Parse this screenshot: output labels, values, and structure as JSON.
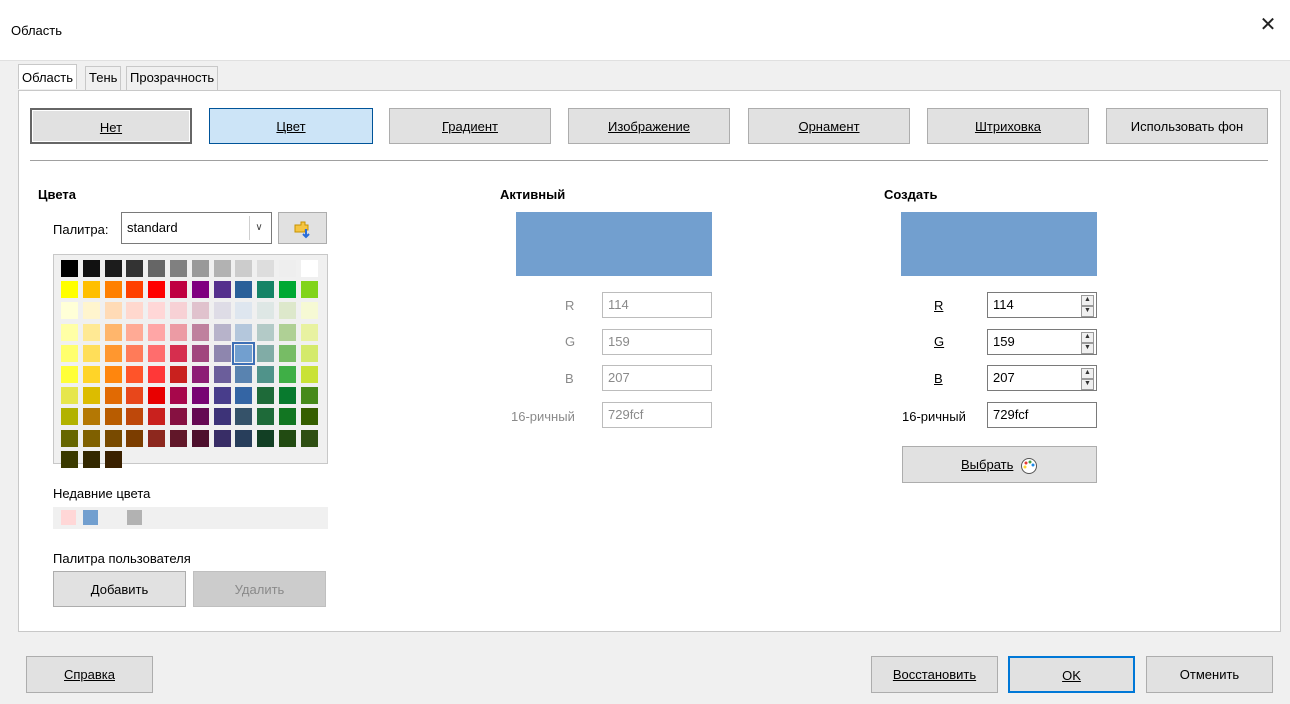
{
  "window": {
    "title": "Область",
    "close_glyph": "✕"
  },
  "tabs": [
    "Область",
    "Тень",
    "Прозрачность"
  ],
  "fill_buttons": [
    {
      "label": "Нет"
    },
    {
      "label": "Цвет"
    },
    {
      "label": "Градиент"
    },
    {
      "label": "Изображение"
    },
    {
      "label": "Орнамент"
    },
    {
      "label": "Штриховка"
    },
    {
      "label": "Использовать фон"
    }
  ],
  "colors_section": {
    "heading": "Цвета",
    "palette_label": "Палитра:",
    "palette_value": "standard",
    "recent_label": "Недавние цвета",
    "custom_palette_label": "Палитра пользователя",
    "add_button": "Добавить",
    "delete_button": "Удалить"
  },
  "palette_colors": [
    [
      "#000000",
      "#111111",
      "#1c1c1c",
      "#333333",
      "#666666",
      "#808080",
      "#999999",
      "#b2b2b2",
      "#cccccc",
      "#dddddd",
      "#eeeeee",
      "#ffffff"
    ],
    [
      "#ffff00",
      "#ffbf00",
      "#ff8000",
      "#ff4000",
      "#ff0000",
      "#bf0041",
      "#800080",
      "#55308d",
      "#2a6099",
      "#158466",
      "#00a933",
      "#81d41a"
    ],
    [
      "#ffffd7",
      "#fff5ce",
      "#ffdbb6",
      "#ffd8ce",
      "#ffd7d7",
      "#f7d1d5",
      "#e0c2cd",
      "#dedce6",
      "#dee6ef",
      "#dee7e5",
      "#dde8cb",
      "#f6f9d4"
    ],
    [
      "#ffffa6",
      "#ffe994",
      "#ffb66c",
      "#ffaa95",
      "#ffa6a6",
      "#ec9ba4",
      "#bf819e",
      "#b7b3ca",
      "#b4c7dc",
      "#b3cac7",
      "#afd095",
      "#e8f2a1"
    ],
    [
      "#ffff6d",
      "#ffde59",
      "#ff972f",
      "#ff7b59",
      "#ff6d6d",
      "#d62e4e",
      "#a1467e",
      "#8e86ae",
      "#729fcf",
      "#81aca6",
      "#77bc65",
      "#d4ea6b"
    ],
    [
      "#ffff38",
      "#ffd428",
      "#ff860d",
      "#ff5429",
      "#ff3838",
      "#c9211e",
      "#8d1d75",
      "#6b5e9b",
      "#5983b0",
      "#50938a",
      "#3faf46",
      "#c9e236"
    ],
    [
      "#e6e64c",
      "#dcbc00",
      "#e16a03",
      "#e8471b",
      "#e80000",
      "#a7074b",
      "#780373",
      "#483d8b",
      "#3465a4",
      "#1e6a39",
      "#087a2e",
      "#468a1a"
    ],
    [
      "#b2b200",
      "#b47804",
      "#b85c00",
      "#be480a",
      "#c9211e",
      "#861141",
      "#650953",
      "#3d3378",
      "#355269",
      "#1e6a39",
      "#127622",
      "#355e00"
    ],
    [
      "#666600",
      "#7f6000",
      "#784a00",
      "#7b3d00",
      "#8d281e",
      "#611729",
      "#4e102d",
      "#382d66",
      "#283e5b",
      "#123f24",
      "#224b12",
      "#2f4f13"
    ],
    [
      "#3a3a00",
      "#332800",
      "#3a2100"
    ]
  ],
  "recent_colors": [
    "#ffd7d7",
    "#729fcf",
    "#f0f0f0",
    "#b2b2b2"
  ],
  "active": {
    "heading": "Активный",
    "color": "#729fcf",
    "r_label": "R",
    "r": "114",
    "g_label": "G",
    "g": "159",
    "b_label": "B",
    "b": "207",
    "hex_label": "16-ричный",
    "hex": "729fcf"
  },
  "create": {
    "heading": "Создать",
    "color": "#729fcf",
    "r_label": "R",
    "r": "114",
    "g_label": "G",
    "g": "159",
    "b_label": "B",
    "b": "207",
    "hex_label": "16-ричный",
    "hex": "729fcf",
    "pick_button": "Выбрать"
  },
  "footer": {
    "help": "Справка",
    "reset": "Восстановить",
    "ok": "OK",
    "cancel": "Отменить"
  }
}
